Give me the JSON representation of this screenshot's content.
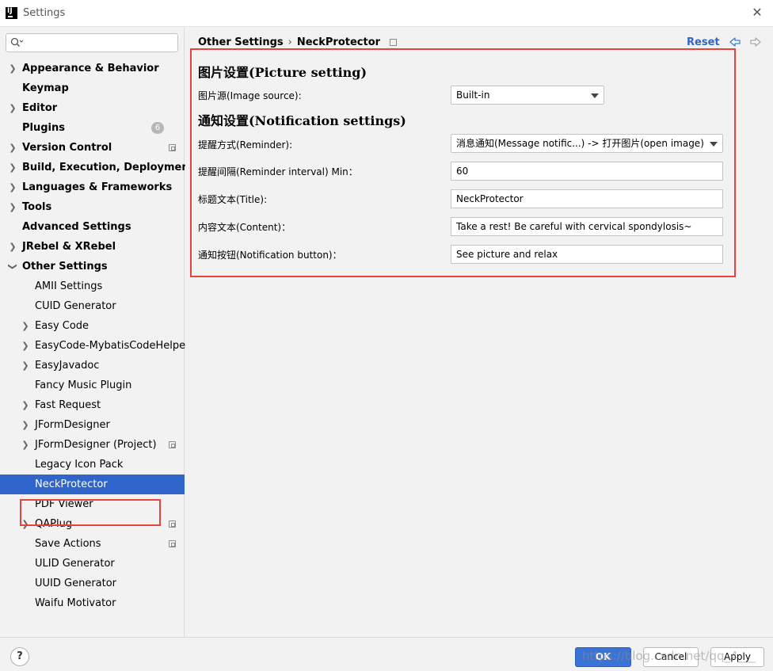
{
  "window": {
    "title": "Settings"
  },
  "sidebar": {
    "search": {
      "value": "",
      "placeholder": ""
    },
    "items": [
      {
        "label": "Appearance & Behavior",
        "expandable": true
      },
      {
        "label": "Keymap",
        "expandable": false
      },
      {
        "label": "Editor",
        "expandable": true
      },
      {
        "label": "Plugins",
        "expandable": false,
        "badge": "6"
      },
      {
        "label": "Version Control",
        "expandable": true
      },
      {
        "label": "Build, Execution, Deployment",
        "expandable": true
      },
      {
        "label": "Languages & Frameworks",
        "expandable": true
      },
      {
        "label": "Tools",
        "expandable": true
      },
      {
        "label": "Advanced Settings",
        "expandable": false
      },
      {
        "label": "JRebel & XRebel",
        "expandable": true
      },
      {
        "label": "Other Settings",
        "expandable": true,
        "expanded": true
      }
    ],
    "children": [
      {
        "label": "AMII Settings"
      },
      {
        "label": "CUID Generator"
      },
      {
        "label": "Easy Code"
      },
      {
        "label": "EasyCode-MybatisCodeHelper"
      },
      {
        "label": "EasyJavadoc"
      },
      {
        "label": "Fancy Music Plugin"
      },
      {
        "label": "Fast Request"
      },
      {
        "label": "JFormDesigner"
      },
      {
        "label": "JFormDesigner (Project)"
      },
      {
        "label": "Legacy Icon Pack"
      },
      {
        "label": "NeckProtector",
        "selected": true
      },
      {
        "label": "PDF Viewer"
      },
      {
        "label": "QAPlug"
      },
      {
        "label": "Save Actions"
      },
      {
        "label": "ULID Generator"
      },
      {
        "label": "UUID Generator"
      },
      {
        "label": "Waifu Motivator"
      }
    ]
  },
  "header": {
    "breadcrumb_parent": "Other Settings",
    "breadcrumb_separator": "›",
    "breadcrumb_current": "NeckProtector",
    "reset_label": "Reset"
  },
  "form": {
    "picture_section_title": "图片设置(Picture setting)",
    "image_source_label": "图片源(Image source):",
    "image_source_value": "Built-in",
    "notification_section_title": "通知设置(Notification settings)",
    "reminder_label": "提醒方式(Reminder):",
    "reminder_value": "消息通知(Message notific...) -> 打开图片(open image)",
    "interval_label": "提醒间隔(Reminder interval) Min：",
    "interval_value": "60",
    "title_label": "标题文本(Title):",
    "title_value": "NeckProtector",
    "content_label": "内容文本(Content)：",
    "content_value": "Take a rest! Be careful with cervical spondylosis~",
    "button_label": "通知按钮(Notification button)：",
    "button_value": "See picture and relax"
  },
  "footer": {
    "help_label": "?",
    "ok_label": "OK",
    "cancel_label": "Cancel",
    "apply_label": "Apply",
    "watermark": "https://blog.csdn.net/qq_4___"
  },
  "colors": {
    "selection": "#2f65ca",
    "link": "#2f65ca",
    "highlight_border": "#e8423d",
    "primary_button": "#3973d7"
  }
}
